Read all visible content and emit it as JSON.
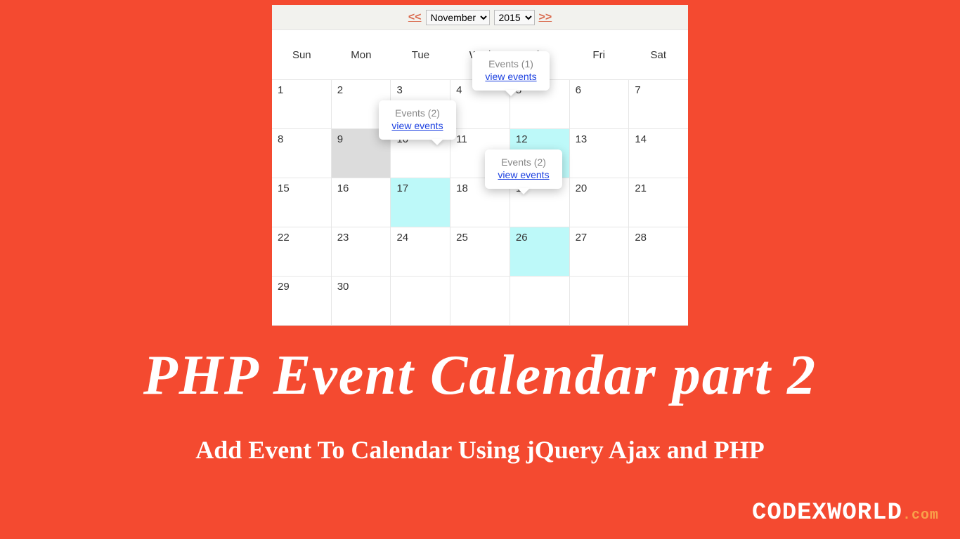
{
  "nav": {
    "prev": "<<",
    "next": ">>",
    "month_selected": "November",
    "year_selected": "2015"
  },
  "day_headers": [
    "Sun",
    "Mon",
    "Tue",
    "Wed",
    "Thu",
    "Fri",
    "Sat"
  ],
  "weeks": [
    [
      {
        "n": "1"
      },
      {
        "n": "2"
      },
      {
        "n": "3"
      },
      {
        "n": "4"
      },
      {
        "n": "5"
      },
      {
        "n": "6"
      },
      {
        "n": "7"
      }
    ],
    [
      {
        "n": "8"
      },
      {
        "n": "9",
        "grey": true
      },
      {
        "n": "10"
      },
      {
        "n": "11"
      },
      {
        "n": "12",
        "event": true
      },
      {
        "n": "13"
      },
      {
        "n": "14"
      }
    ],
    [
      {
        "n": "15"
      },
      {
        "n": "16"
      },
      {
        "n": "17",
        "event": true
      },
      {
        "n": "18"
      },
      {
        "n": "19"
      },
      {
        "n": "20"
      },
      {
        "n": "21"
      }
    ],
    [
      {
        "n": "22"
      },
      {
        "n": "23"
      },
      {
        "n": "24"
      },
      {
        "n": "25"
      },
      {
        "n": "26",
        "event": true
      },
      {
        "n": "27"
      },
      {
        "n": "28"
      }
    ],
    [
      {
        "n": "29"
      },
      {
        "n": "30"
      },
      {
        "n": ""
      },
      {
        "n": ""
      },
      {
        "n": ""
      },
      {
        "n": ""
      },
      {
        "n": ""
      }
    ]
  ],
  "tooltips": {
    "t1": {
      "title": "Events (1)",
      "link": "view events"
    },
    "t2": {
      "title": "Events (2)",
      "link": "view events"
    },
    "t3": {
      "title": "Events (2)",
      "link": "view events"
    }
  },
  "headline": "PHP Event Calendar part 2",
  "subhead": "Add Event To Calendar Using jQuery Ajax and PHP",
  "brand_main": "CODEXWORLD",
  "brand_ext": ".com"
}
